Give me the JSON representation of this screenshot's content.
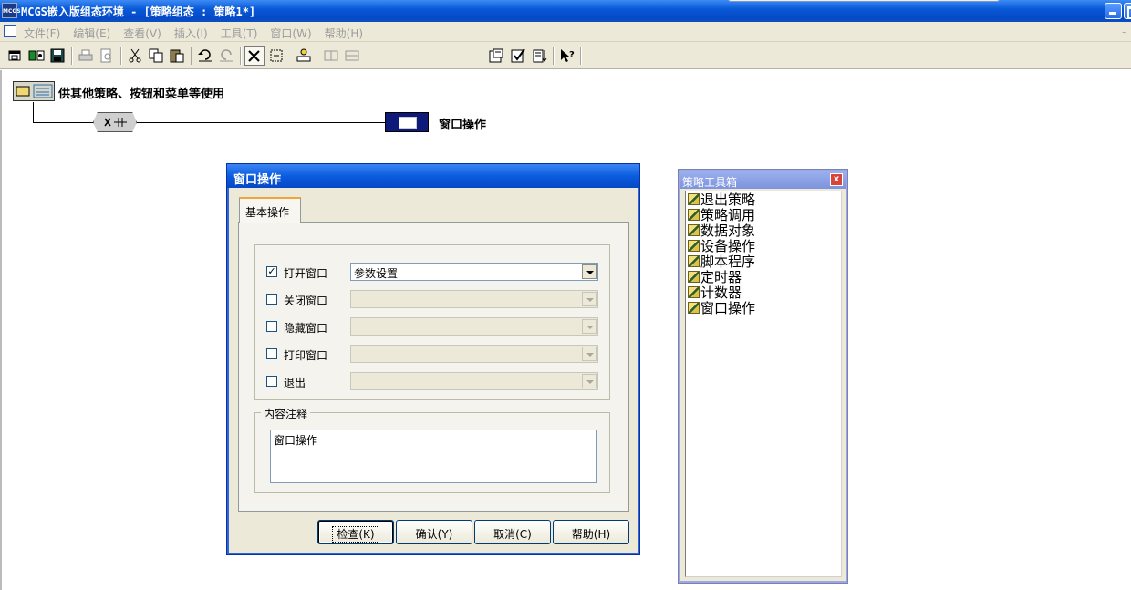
{
  "window": {
    "app_icon_text": "MCGS",
    "title": "MCGS嵌入版组态环境 - [策略组态 : 策略1*]"
  },
  "menu": {
    "items": [
      "文件(F)",
      "编辑(E)",
      "查看(V)",
      "插入(I)",
      "工具(T)",
      "窗口(W)",
      "帮助(H)"
    ],
    "mdi_close": "-"
  },
  "strategy": {
    "title": "供其他策略、按钮和菜单等使用",
    "action_label": "窗口操作"
  },
  "dialog": {
    "title": "窗口操作",
    "tab": "基本操作",
    "operations": [
      {
        "label": "打开窗口",
        "checked": true,
        "check_mark": "✓",
        "value": "参数设置"
      },
      {
        "label": "关闭窗口",
        "checked": false,
        "check_mark": "",
        "value": ""
      },
      {
        "label": "隐藏窗口",
        "checked": false,
        "check_mark": "",
        "value": ""
      },
      {
        "label": "打印窗口",
        "checked": false,
        "check_mark": "",
        "value": ""
      },
      {
        "label": "退出",
        "checked": false,
        "check_mark": "",
        "value": ""
      }
    ],
    "note_legend": "内容注释",
    "note_text": "窗口操作",
    "buttons": {
      "check": "检查(K)",
      "ok": "确认(Y)",
      "cancel": "取消(C)",
      "help": "帮助(H)"
    }
  },
  "toolbox": {
    "title": "策略工具箱",
    "close": "x",
    "items": [
      "退出策略",
      "策略调用",
      "数据对象",
      "设备操作",
      "脚本程序",
      "定时器",
      "计数器",
      "窗口操作"
    ]
  },
  "colors": {
    "titlebar": "#0a5ad8",
    "dialog_face": "#ece9d8",
    "action_node": "#0d1a7a"
  }
}
